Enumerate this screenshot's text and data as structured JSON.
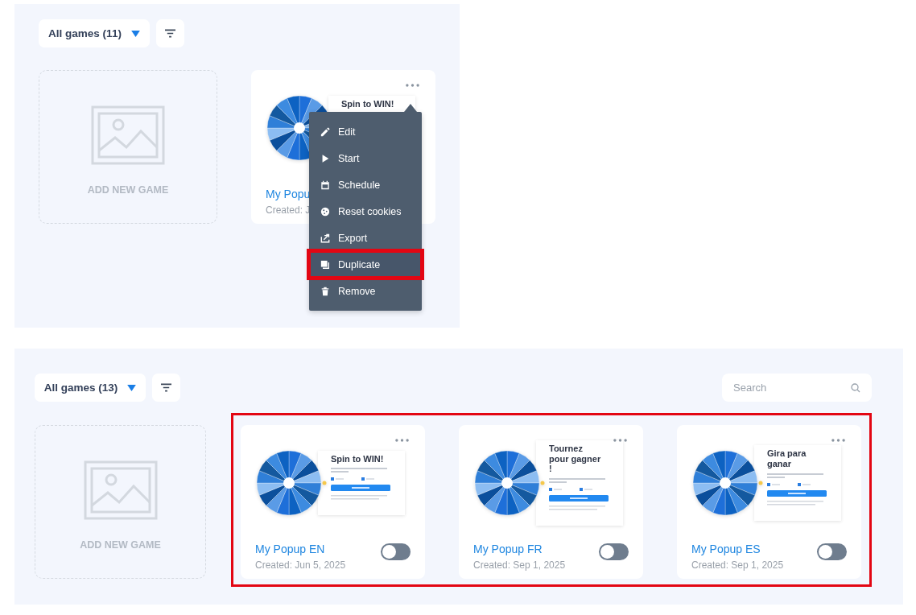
{
  "panels": [
    {
      "filter": {
        "label": "All games (11)"
      },
      "add_card": {
        "label": "ADD NEW GAME"
      },
      "cards_highlighted": false,
      "cards": [
        {
          "preview_title": "Spin to WIN!",
          "title": "My Popu",
          "created": "Created: J",
          "menu": {
            "items": [
              {
                "label": "Edit",
                "highlighted": false
              },
              {
                "label": "Start",
                "highlighted": false
              },
              {
                "label": "Schedule",
                "highlighted": false
              },
              {
                "label": "Reset cookies",
                "highlighted": false
              },
              {
                "label": "Export",
                "highlighted": false
              },
              {
                "label": "Duplicate",
                "highlighted": true
              },
              {
                "label": "Remove",
                "highlighted": false
              }
            ]
          }
        }
      ]
    },
    {
      "filter": {
        "label": "All games (13)"
      },
      "search": {
        "placeholder": "Search"
      },
      "add_card": {
        "label": "ADD NEW GAME"
      },
      "cards_highlighted": true,
      "cards": [
        {
          "preview_title": "Spin to WIN!",
          "title": "My Popup EN",
          "created": "Created: Jun 5, 2025",
          "on": false
        },
        {
          "preview_title": "Tournez pour gagner !",
          "title": "My Popup FR",
          "created": "Created: Sep 1, 2025",
          "on": false
        },
        {
          "preview_title": "Gira para ganar",
          "title": "My Popup ES",
          "created": "Created: Sep 1, 2025",
          "on": false
        }
      ]
    }
  ]
}
